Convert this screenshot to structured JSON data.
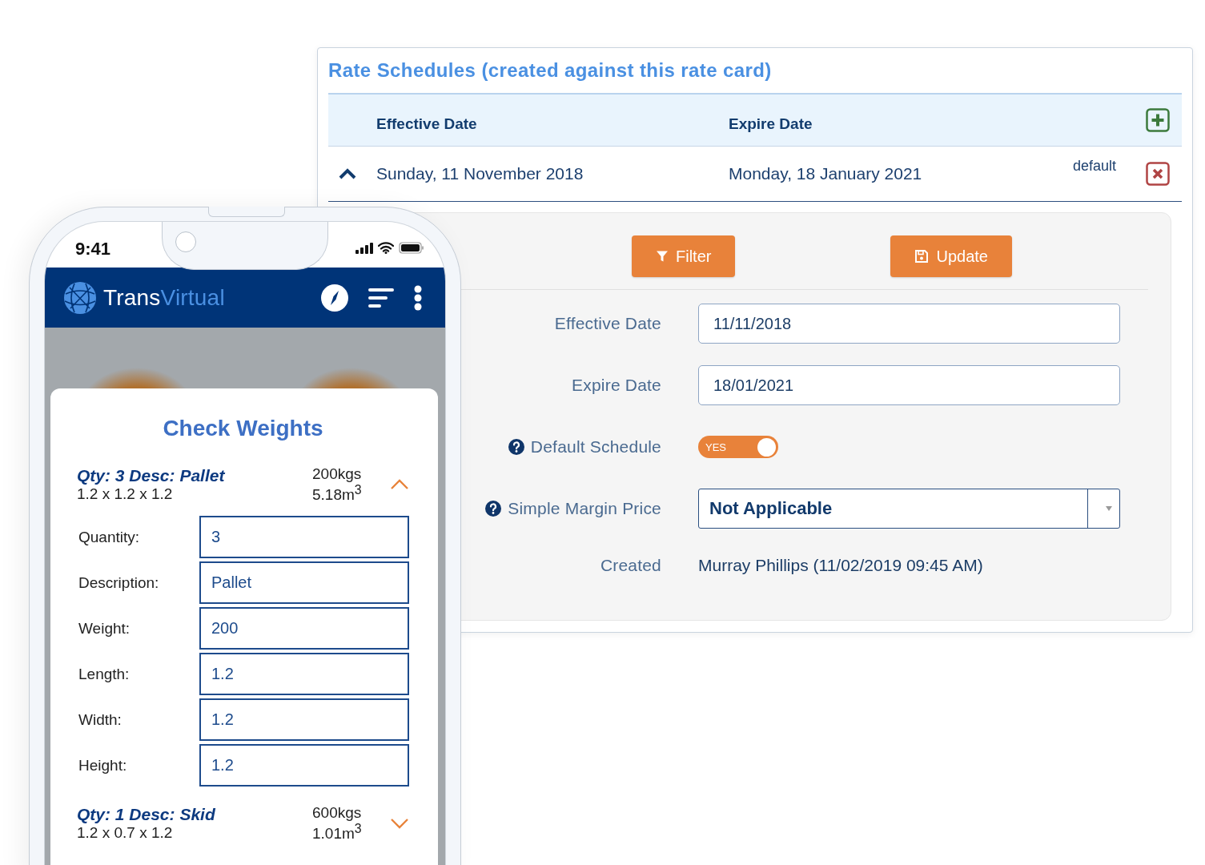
{
  "panel": {
    "title": "Rate Schedules (created against this rate card)",
    "table": {
      "columns": [
        "Effective Date",
        "Expire Date"
      ],
      "rows": [
        {
          "expanded": true,
          "effective": "Sunday, 11 November 2018",
          "expire": "Monday, 18 January 2021",
          "tag": "default"
        }
      ]
    },
    "buttons": [
      {
        "kind": "filter",
        "label": "Filter"
      },
      {
        "kind": "save",
        "label": "Update"
      }
    ],
    "form": [
      {
        "kind": "input",
        "label": "Effective Date",
        "help": false,
        "value": "11/11/2018"
      },
      {
        "kind": "input",
        "label": "Expire Date",
        "help": false,
        "value": "18/01/2021"
      },
      {
        "kind": "toggle",
        "label": "Default Schedule",
        "help": true,
        "on": true,
        "value": "YES"
      },
      {
        "kind": "select",
        "label": "Simple Margin Price",
        "help": true,
        "value": "Not Applicable"
      },
      {
        "kind": "text",
        "label": "Created",
        "help": false,
        "value": "Murray Phillips (11/02/2019 09:45 AM)"
      }
    ]
  },
  "phone": {
    "time": "9:41",
    "brand": {
      "first": "Trans",
      "second": "Virtual"
    },
    "card": {
      "title": "Check Weights",
      "items": [
        {
          "title": "Qty: 3 Desc: Pallet",
          "dims": "1.2 x 1.2 x 1.2",
          "weight": "200kgs",
          "volume": "5.18m$^{3}$",
          "expanded": true,
          "fields": [
            {
              "label": "Quantity:",
              "value": "3"
            },
            {
              "label": "Description:",
              "value": "Pallet"
            },
            {
              "label": "Weight:",
              "value": "200"
            },
            {
              "label": "Length:",
              "value": "1.2"
            },
            {
              "label": "Width:",
              "value": "1.2"
            },
            {
              "label": "Height:",
              "value": "1.2"
            }
          ]
        },
        {
          "title": "Qty: 1 Desc: Skid",
          "dims": "1.2 x 0.7 x 1.2",
          "weight": "600kgs",
          "volume": "1.01m$^{3}$",
          "expanded": false
        }
      ]
    }
  }
}
